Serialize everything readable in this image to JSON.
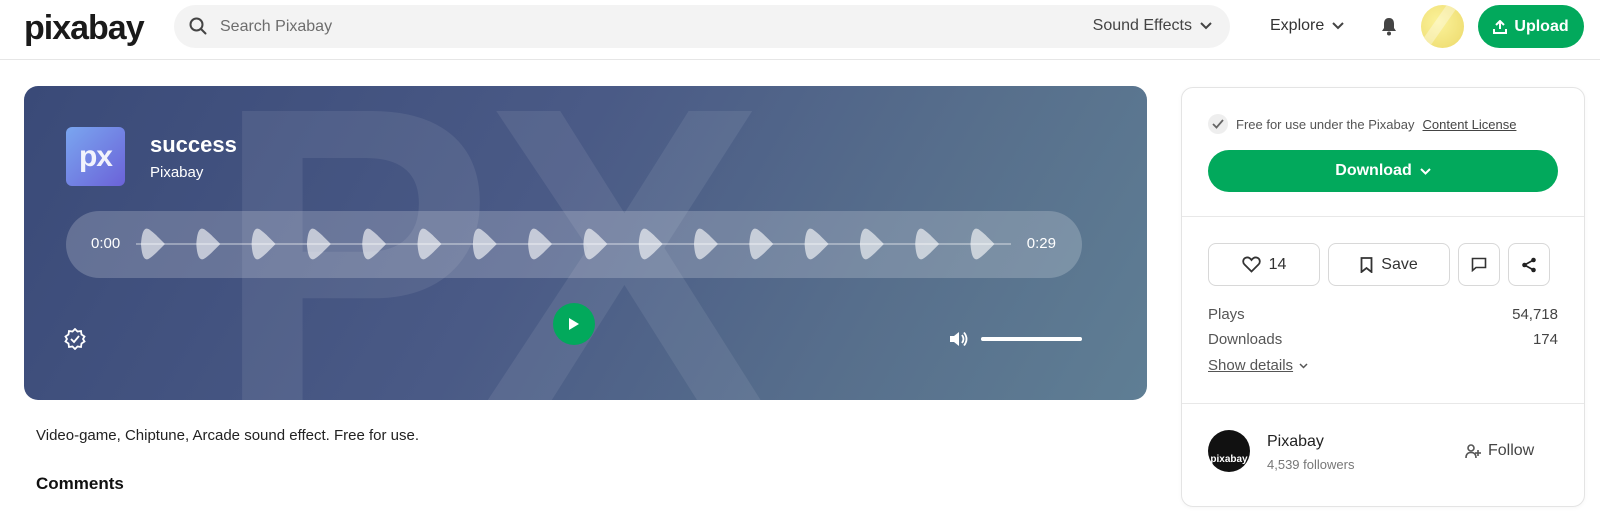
{
  "header": {
    "logo": "pixabay",
    "search_placeholder": "Search Pixabay",
    "search_scope": "Sound Effects",
    "explore": "Explore",
    "upload": "Upload",
    "accent_color": "#02a95c"
  },
  "player": {
    "thumb_text": "px",
    "title": "success",
    "author": "Pixabay",
    "time_current": "0:00",
    "time_total": "0:29",
    "volume_level": 1.0
  },
  "description": "Video-game, Chiptune, Arcade sound effect. Free for use.",
  "comments_heading": "Comments",
  "panel": {
    "license_text": "Free for use under the Pixabay",
    "license_link": "Content License",
    "download": "Download",
    "likes": "14",
    "save": "Save",
    "stats": [
      {
        "label": "Plays",
        "value": "54,718"
      },
      {
        "label": "Downloads",
        "value": "174"
      }
    ],
    "show_details": "Show details",
    "profile": {
      "avatar_text": "pixabay",
      "name": "Pixabay",
      "followers": "4,539 followers",
      "follow": "Follow"
    }
  }
}
